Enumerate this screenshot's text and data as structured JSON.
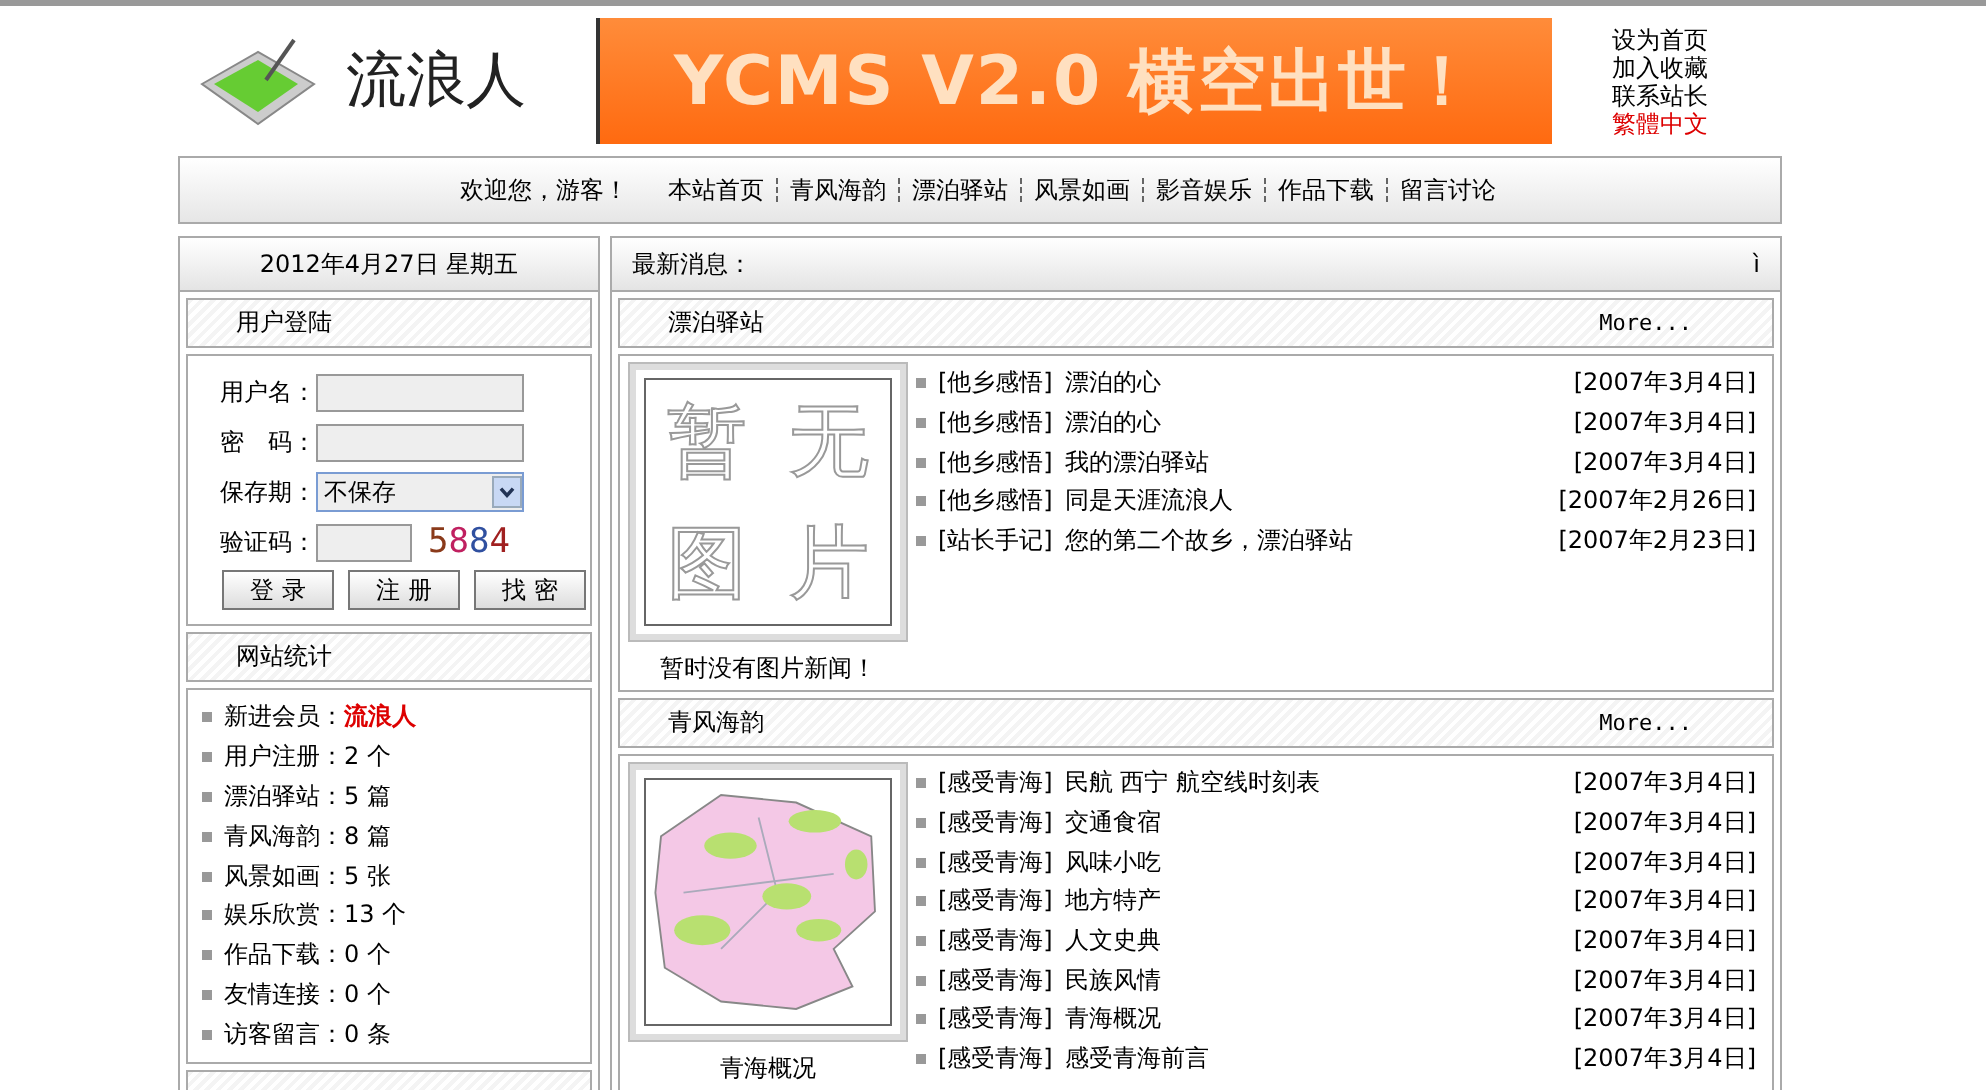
{
  "header": {
    "logo_text": "流浪人",
    "banner_text": "YCMS V2.0 横空出世！",
    "links": [
      {
        "label": "设为首页",
        "highlight": false
      },
      {
        "label": "加入收藏",
        "highlight": false
      },
      {
        "label": "联系站长",
        "highlight": false
      },
      {
        "label": "繁體中文",
        "highlight": true
      }
    ]
  },
  "nav": {
    "greeting": "欢迎您，游客！",
    "items": [
      "本站首页",
      "青风海韵",
      "漂泊驿站",
      "风景如画",
      "影音娱乐",
      "作品下载",
      "留言讨论"
    ]
  },
  "date": "2012年4月27日 星期五",
  "login": {
    "title": "用户登陆",
    "fields": [
      {
        "kind": "text",
        "label": "用户名："
      },
      {
        "kind": "password",
        "label": "密　码："
      },
      {
        "kind": "select",
        "label": "保存期：",
        "value": "不保存"
      },
      {
        "kind": "captcha",
        "label": "验证码：",
        "code": "5884"
      }
    ],
    "buttons": [
      "登 录",
      "注 册",
      "找 密"
    ]
  },
  "stats": {
    "title": "网站统计",
    "items": [
      {
        "label": "新进会员：",
        "value": "流浪人",
        "highlight": true
      },
      {
        "label": "用户注册：",
        "value": "2 个",
        "highlight": false
      },
      {
        "label": "漂泊驿站：",
        "value": "5 篇",
        "highlight": false
      },
      {
        "label": "青风海韵：",
        "value": "8 篇",
        "highlight": false
      },
      {
        "label": "风景如画：",
        "value": "5 张",
        "highlight": false
      },
      {
        "label": "娱乐欣赏：",
        "value": "13 个",
        "highlight": false
      },
      {
        "label": "作品下载：",
        "value": "0 个",
        "highlight": false
      },
      {
        "label": "友情连接：",
        "value": "0 个",
        "highlight": false
      },
      {
        "label": "访客留言：",
        "value": "0 条",
        "highlight": false
      }
    ]
  },
  "news": {
    "label": "最新消息：",
    "marquee": "ì"
  },
  "sections": [
    {
      "title": "漂泊驿站",
      "more": "More...",
      "image": {
        "kind": "placeholder",
        "text": "暂无图片"
      },
      "caption": "暂时没有图片新闻！",
      "items": [
        {
          "category": "[他乡感悟]",
          "title": "漂泊的心",
          "date": "[2007年3月4日]"
        },
        {
          "category": "[他乡感悟]",
          "title": "漂泊的心",
          "date": "[2007年3月4日]"
        },
        {
          "category": "[他乡感悟]",
          "title": "我的漂泊驿站",
          "date": "[2007年3月4日]"
        },
        {
          "category": "[他乡感悟]",
          "title": "同是天涯流浪人",
          "date": "[2007年2月26日]"
        },
        {
          "category": "[站长手记]",
          "title": "您的第二个故乡，漂泊驿站",
          "date": "[2007年2月23日]"
        }
      ]
    },
    {
      "title": "青风海韵",
      "more": "More...",
      "image": {
        "kind": "picture"
      },
      "caption": "青海概况",
      "items": [
        {
          "category": "[感受青海]",
          "title": "民航 西宁 航空线时刻表",
          "date": "[2007年3月4日]"
        },
        {
          "category": "[感受青海]",
          "title": "交通食宿",
          "date": "[2007年3月4日]"
        },
        {
          "category": "[感受青海]",
          "title": "风味小吃",
          "date": "[2007年3月4日]"
        },
        {
          "category": "[感受青海]",
          "title": "地方特产",
          "date": "[2007年3月4日]"
        },
        {
          "category": "[感受青海]",
          "title": "人文史典",
          "date": "[2007年3月4日]"
        },
        {
          "category": "[感受青海]",
          "title": "民族风情",
          "date": "[2007年3月4日]"
        },
        {
          "category": "[感受青海]",
          "title": "青海概况",
          "date": "[2007年3月4日]"
        },
        {
          "category": "[感受青海]",
          "title": "感受青海前言",
          "date": "[2007年3月4日]"
        }
      ]
    }
  ]
}
